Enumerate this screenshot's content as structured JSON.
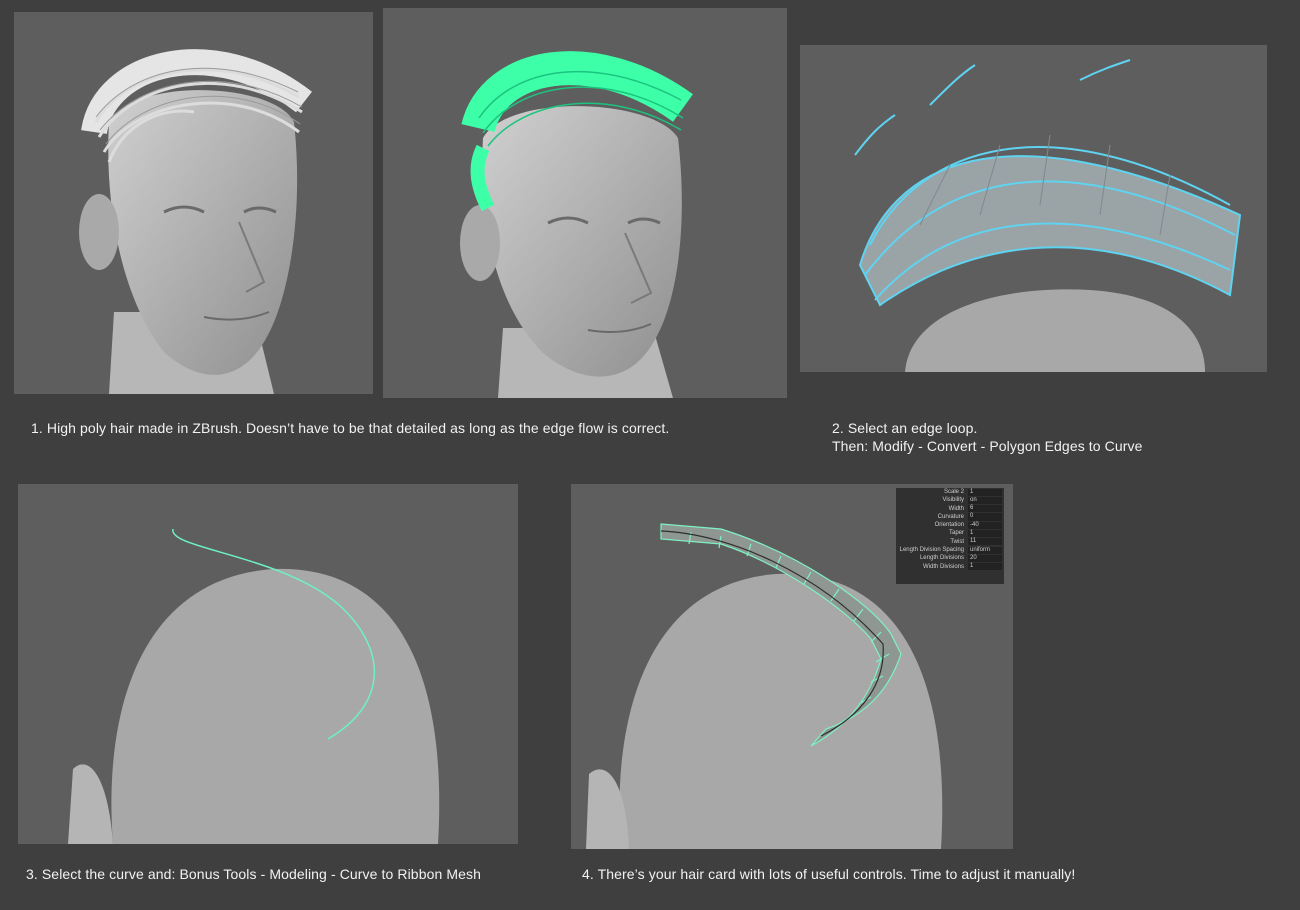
{
  "captions": {
    "step1": "1. High poly hair made in ZBrush. Doesn’t have to be that detailed as long as the edge flow is correct.",
    "step2_line1": "2. Select an edge loop.",
    "step2_line2": "Then: Modify - Convert - Polygon Edges to Curve",
    "step3": "3. Select the curve and: Bonus Tools - Modeling - Curve to Ribbon Mesh",
    "step4": "4. There’s your hair card with lots of useful controls. Time to adjust it manually!"
  },
  "attributes": [
    {
      "label": "Scale 2",
      "value": "1"
    },
    {
      "label": "Visibility",
      "value": "on"
    },
    {
      "label": "Width",
      "value": "6"
    },
    {
      "label": "Curvature",
      "value": "0"
    },
    {
      "label": "Orientation",
      "value": "-40"
    },
    {
      "label": "Taper",
      "value": "1"
    },
    {
      "label": "Twist",
      "value": "11"
    },
    {
      "label": "Length Division Spacing",
      "value": "uniform"
    },
    {
      "label": "Length Divisions",
      "value": "20"
    },
    {
      "label": "Width Divisions",
      "value": "1"
    }
  ],
  "colors": {
    "background": "#3f3f3f",
    "viewport": "#5e5e5e",
    "mesh": "#c9c9c9",
    "hair_selected": "#3dffa8",
    "wireframe_cyan": "#5fd3f0",
    "curve": "#6ef0c8"
  }
}
